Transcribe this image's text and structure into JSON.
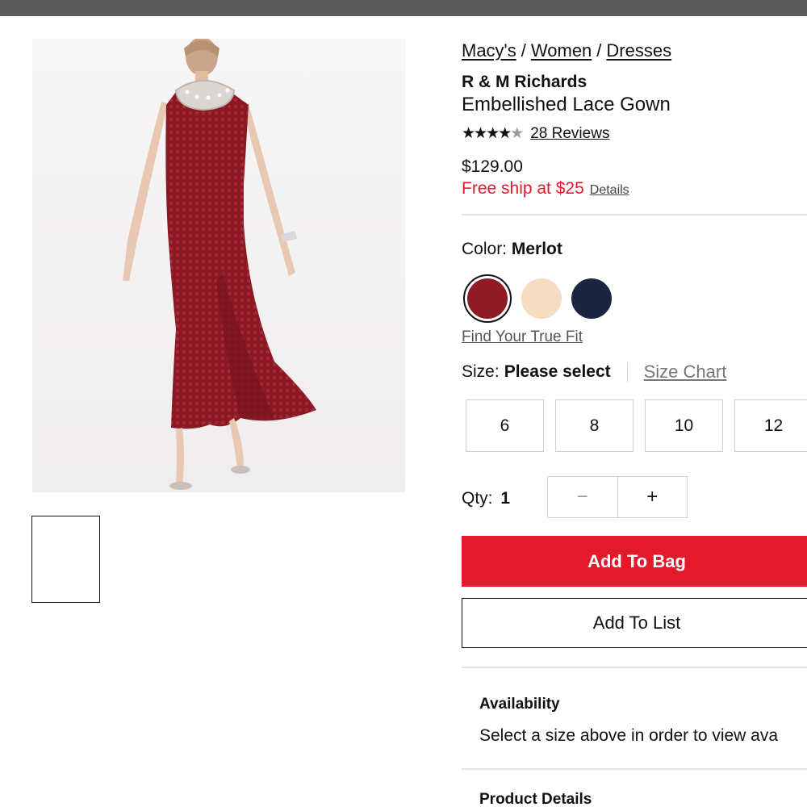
{
  "breadcrumb": {
    "items": [
      "Macy's",
      "Women",
      "Dresses"
    ],
    "separator": "/"
  },
  "product": {
    "brand": "R & M Richards",
    "name": "Embellished Lace Gown",
    "rating": 4.5,
    "rating_max": 5,
    "reviews_label": "28 Reviews",
    "price": "$129.00",
    "free_ship": "Free ship at $25",
    "details_link": "Details"
  },
  "color": {
    "label": "Color:",
    "selected": "Merlot",
    "swatches": [
      {
        "name": "Merlot",
        "hex": "#8e1b25",
        "selected": true
      },
      {
        "name": "Champagne",
        "hex": "#f6dcc0",
        "selected": false
      },
      {
        "name": "Navy",
        "hex": "#1b2440",
        "selected": false
      }
    ],
    "true_fit": "Find Your True Fit"
  },
  "size": {
    "label": "Size:",
    "value": "Please select",
    "chart_link": "Size Chart",
    "options": [
      "6",
      "8",
      "10",
      "12"
    ]
  },
  "quantity": {
    "label": "Qty:",
    "value": "1",
    "minus": "−",
    "plus": "+"
  },
  "actions": {
    "add_to_bag": "Add To Bag",
    "add_to_list": "Add To List"
  },
  "availability": {
    "title": "Availability",
    "text": "Select a size above in order to view ava"
  },
  "product_details": {
    "title": "Product Details"
  },
  "colors": {
    "accent_red": "#e21a2c",
    "topbar": "#5a5a5a",
    "dress": "#8e1b25"
  }
}
